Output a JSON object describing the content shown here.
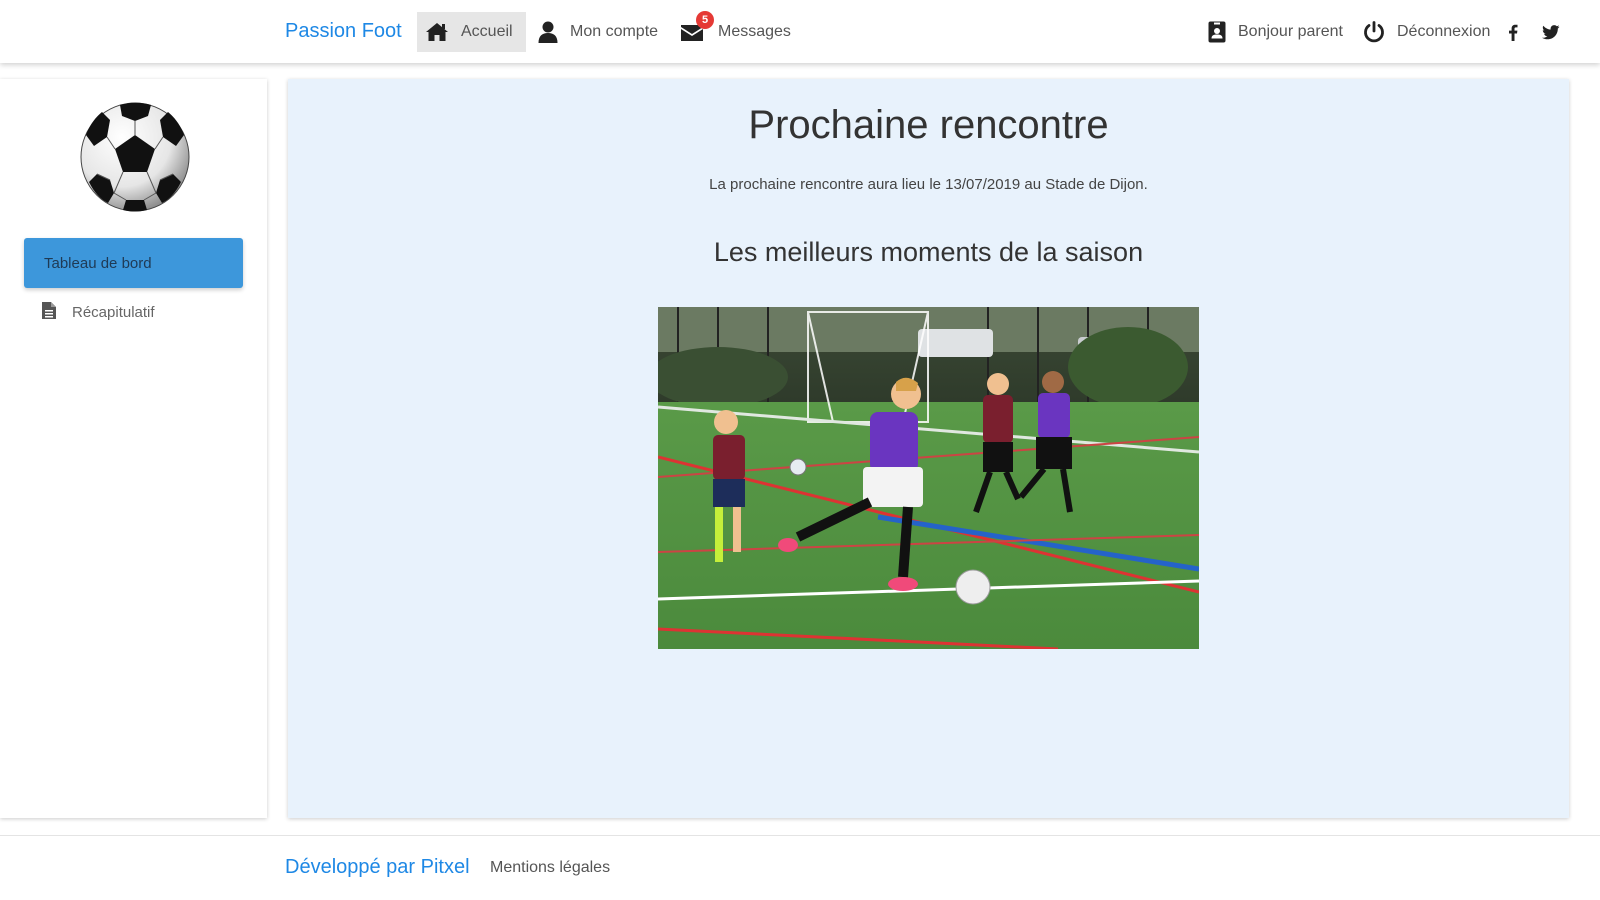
{
  "navbar": {
    "brand": "Passion Foot",
    "items": [
      {
        "label": "Accueil",
        "icon": "home-icon",
        "active": true
      },
      {
        "label": "Mon compte",
        "icon": "user-icon"
      },
      {
        "label": "Messages",
        "icon": "envelope-icon",
        "badge": "5"
      }
    ],
    "right": {
      "parent_label": "Bonjour parent",
      "logout_label": "Déconnexion",
      "social": [
        "facebook-icon",
        "twitter-icon"
      ]
    }
  },
  "sidebar": {
    "avatar": "soccer-ball",
    "items": [
      {
        "label": "Tableau de bord",
        "active": true
      },
      {
        "label": "Récapitulatif",
        "icon": "document-icon"
      }
    ]
  },
  "main": {
    "title": "Prochaine rencontre",
    "subtitle": "La prochaine rencontre aura lieu le 13/07/2019 au Stade de Dijon.",
    "highlights_title": "Les meilleurs moments de la saison"
  },
  "footer": {
    "brand": "Développé par Pitxel",
    "legal": "Mentions légales"
  },
  "colors": {
    "accent": "#1e88e5",
    "sidebar_active": "#3d97db",
    "main_bg": "#e8f2fc",
    "badge": "#e53935"
  }
}
